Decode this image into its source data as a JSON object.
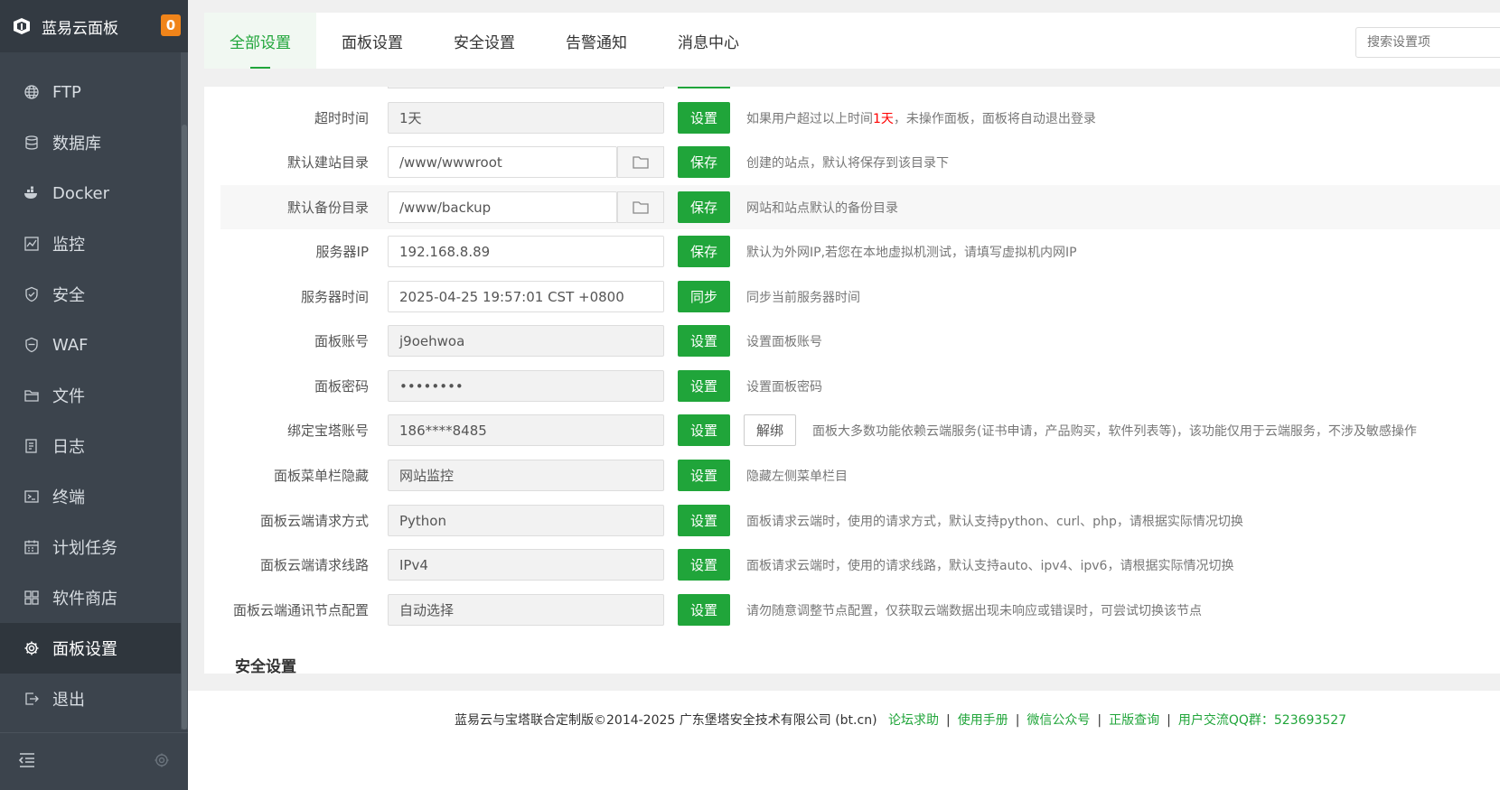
{
  "sidebar": {
    "brand": "蓝易云面板",
    "badge": "0",
    "items": [
      {
        "label": "FTP",
        "icon": "globe-icon"
      },
      {
        "label": "数据库",
        "icon": "database-icon"
      },
      {
        "label": "Docker",
        "icon": "docker-icon"
      },
      {
        "label": "监控",
        "icon": "monitor-icon"
      },
      {
        "label": "安全",
        "icon": "shield-icon"
      },
      {
        "label": "WAF",
        "icon": "waf-icon"
      },
      {
        "label": "文件",
        "icon": "folder-icon"
      },
      {
        "label": "日志",
        "icon": "log-icon"
      },
      {
        "label": "终端",
        "icon": "terminal-icon"
      },
      {
        "label": "计划任务",
        "icon": "calendar-icon"
      },
      {
        "label": "软件商店",
        "icon": "grid-icon"
      },
      {
        "label": "面板设置",
        "icon": "gear-icon"
      },
      {
        "label": "退出",
        "icon": "logout-icon"
      }
    ],
    "active_index": 11
  },
  "tabs": [
    "全部设置",
    "面板设置",
    "安全设置",
    "告警通知",
    "消息中心"
  ],
  "search": {
    "placeholder": "搜索设置项"
  },
  "rows": [
    {
      "label": "超时时间",
      "value": "1天",
      "button": "设置",
      "hint_pre": "如果用户超过以上时间",
      "hint_red": "1天",
      "hint_post": "，未操作面板，面板将自动退出登录"
    },
    {
      "label": "默认建站目录",
      "value": "/www/wwwroot",
      "button": "保存",
      "hint": "创建的站点，默认将保存到该目录下"
    },
    {
      "label": "默认备份目录",
      "value": "/www/backup",
      "button": "保存",
      "hint": "网站和站点默认的备份目录"
    },
    {
      "label": "服务器IP",
      "value": "192.168.8.89",
      "button": "保存",
      "hint": "默认为外网IP,若您在本地虚拟机测试，请填写虚拟机内网IP"
    },
    {
      "label": "服务器时间",
      "value": "2025-04-25 19:57:01 CST +0800",
      "button": "同步",
      "hint": "同步当前服务器时间"
    },
    {
      "label": "面板账号",
      "value": "j9oehwoa",
      "button": "设置",
      "hint": "设置面板账号"
    },
    {
      "label": "面板密码",
      "value": "••••••••",
      "button": "设置",
      "hint": "设置面板密码"
    },
    {
      "label": "绑定宝塔账号",
      "value": "186****8485",
      "button": "设置",
      "button2": "解绑",
      "hint": "面板大多数功能依赖云端服务(证书申请，产品购买，软件列表等)，该功能仅用于云端服务，不涉及敏感操作"
    },
    {
      "label": "面板菜单栏隐藏",
      "value": "网站监控",
      "button": "设置",
      "hint": "隐藏左侧菜单栏目"
    },
    {
      "label": "面板云端请求方式",
      "value": "Python",
      "button": "设置",
      "hint": "面板请求云端时，使用的请求方式，默认支持python、curl、php，请根据实际情况切换"
    },
    {
      "label": "面板云端请求线路",
      "value": "IPv4",
      "button": "设置",
      "hint": "面板请求云端时，使用的请求线路，默认支持auto、ipv4、ipv6，请根据实际情况切换"
    },
    {
      "label": "面板云端通讯节点配置",
      "value": "自动选择",
      "button": "设置",
      "hint": "请勿随意调整节点配置，仅获取云端数据出现未响应或错误时，可尝试切换该节点"
    }
  ],
  "section_title": "安全设置",
  "footer": {
    "copyright": "蓝易云与宝塔联合定制版©2014-2025 广东堡塔安全技术有限公司 (bt.cn)",
    "links": [
      "论坛求助",
      "使用手册",
      "微信公众号",
      "正版查询",
      "用户交流QQ群：523693527"
    ]
  },
  "colors": {
    "accent": "#20a53a",
    "sidebar": "#3c444d",
    "badge": "#f0841a"
  }
}
